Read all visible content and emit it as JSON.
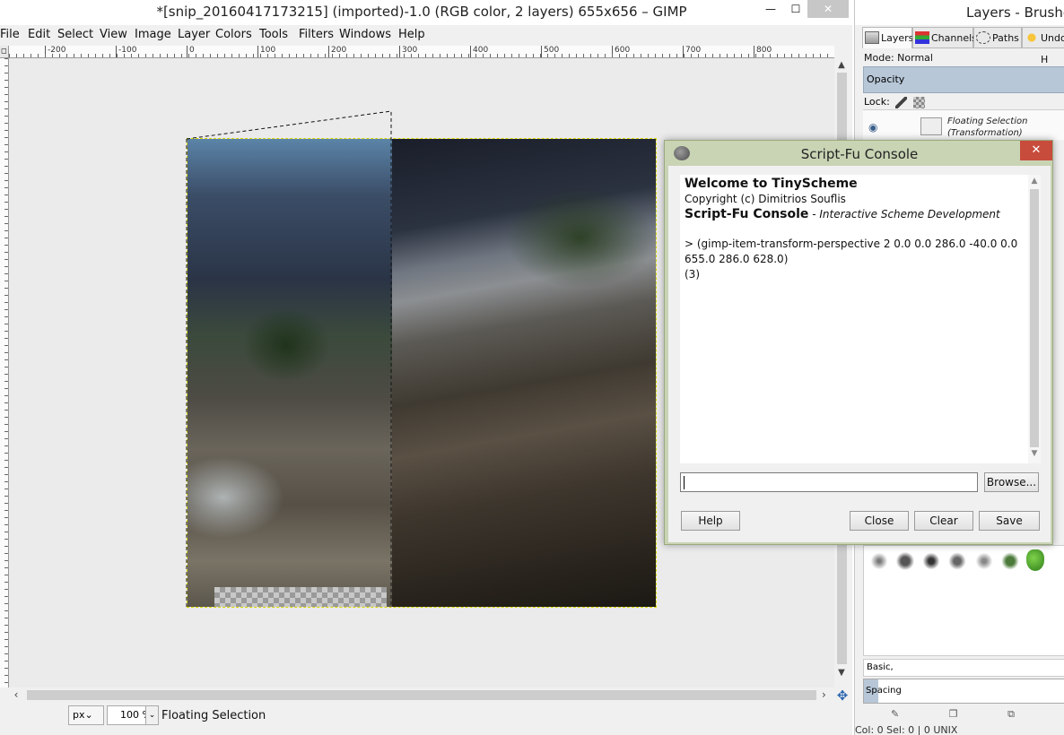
{
  "main_window": {
    "title": "*[snip_20160417173215] (imported)-1.0 (RGB color, 2 layers) 655x656 – GIMP",
    "min_icon": "—",
    "max_icon": "☐",
    "close_icon": "✕"
  },
  "menu": {
    "items": [
      {
        "label": "File"
      },
      {
        "label": "Edit"
      },
      {
        "label": "Select"
      },
      {
        "label": "View"
      },
      {
        "label": "Image"
      },
      {
        "label": "Layer"
      },
      {
        "label": "Colors"
      },
      {
        "label": "Tools"
      },
      {
        "label": "Filters"
      },
      {
        "label": "Windows"
      },
      {
        "label": "Help"
      }
    ]
  },
  "ruler": {
    "ticks": [
      "-200",
      "-100",
      "0",
      "100",
      "200",
      "300",
      "400",
      "500",
      "600",
      "700",
      "800"
    ]
  },
  "status": {
    "unit": "px",
    "unit_arrow": "⌄",
    "zoom": "100 %",
    "zoom_arrow": "⌄",
    "message": "Floating Selection"
  },
  "dock": {
    "title": "Layers - Brushes",
    "tabs": [
      {
        "label": "Layers",
        "icon": "layers-icon"
      },
      {
        "label": "Channels",
        "icon": "channels-icon"
      },
      {
        "label": "Paths",
        "icon": "paths-icon"
      },
      {
        "label": "Undo H",
        "icon": "undo-icon"
      }
    ],
    "mode_label": "Mode: Normal",
    "opacity_label": "Opacity",
    "lock_label": "Lock:",
    "layer": {
      "name_line1": "Floating Selection",
      "name_line2": "(Transformation)"
    },
    "brush_tag": "Basic,",
    "spacing_label": "Spacing",
    "status": "Col: 0   Sel: 0 | 0          UNIX"
  },
  "dialog": {
    "title": "Script-Fu Console",
    "close_label": "✕",
    "welcome": "Welcome to TinyScheme",
    "copyright": "Copyright (c) Dimitrios Souflis",
    "console_title": "Script-Fu Console",
    "console_subtitle": " - Interactive Scheme Development",
    "command_line1": "> (gimp-item-transform-perspective 2 0.0 0.0 286.0 -40.0 0.0",
    "command_line2": "655.0 286.0 628.0)",
    "result": "(3)",
    "input_value": "",
    "browse_label": "Browse...",
    "help_label": "Help",
    "close_button_label": "Close",
    "clear_label": "Clear",
    "save_label": "Save"
  }
}
